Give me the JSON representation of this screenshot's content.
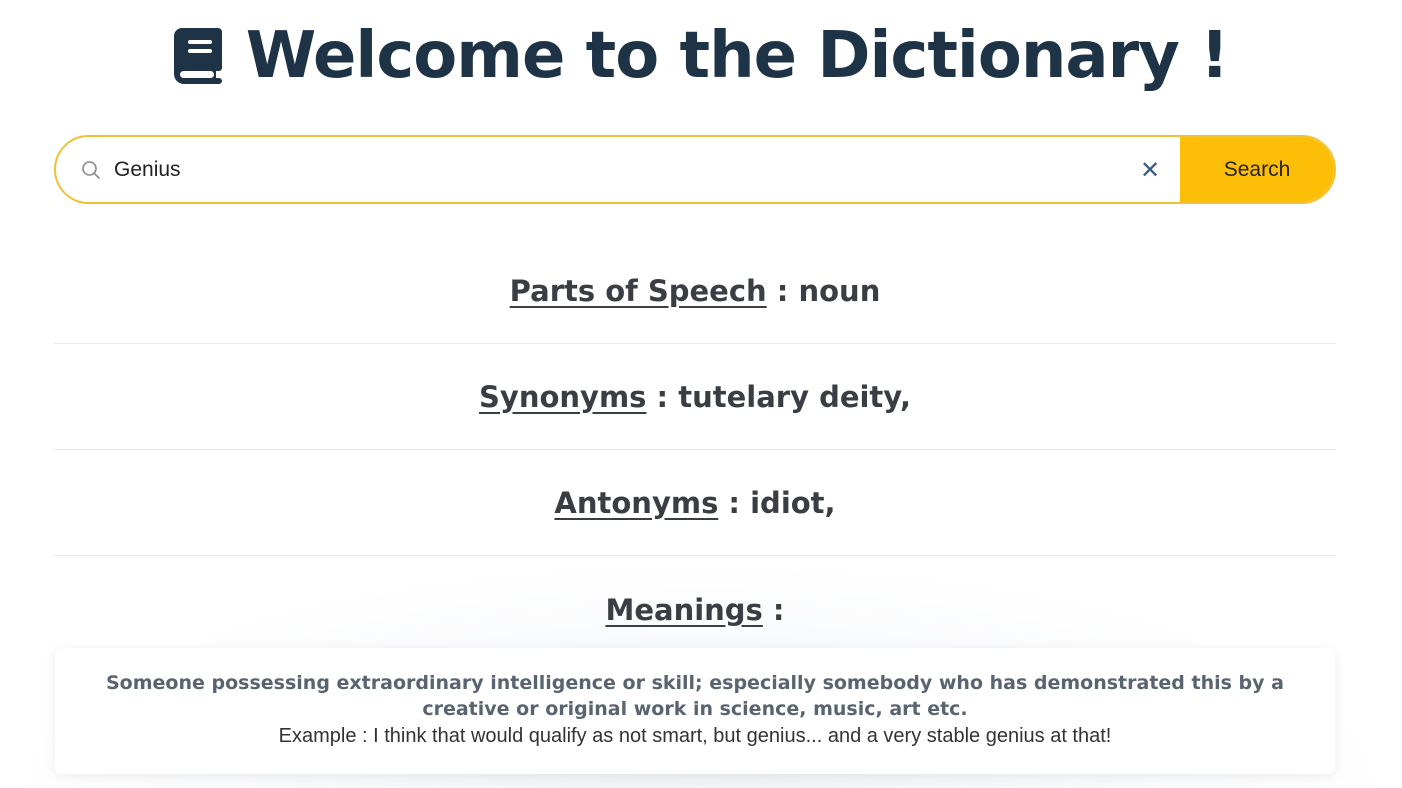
{
  "header": {
    "title": "Welcome to the Dictionary !",
    "icon": "book-icon"
  },
  "search": {
    "value": "Genius",
    "placeholder": "",
    "icon": "search-icon",
    "clear_label": "✕",
    "button_label": "Search",
    "accent_color": "#fcbe06"
  },
  "results": {
    "parts_of_speech": {
      "label": "Parts of Speech",
      "value": " : noun"
    },
    "synonyms": {
      "label": "Synonyms",
      "value": " : tutelary deity,"
    },
    "antonyms": {
      "label": "Antonyms",
      "value": " : idiot,"
    },
    "meanings": {
      "label": "Meanings",
      "suffix": " :",
      "items": [
        {
          "definition": "Someone possessing extraordinary intelligence or skill; especially somebody who has demonstrated this by a creative or original work in science, music, art etc.",
          "example": "Example : I think that would qualify as not smart, but genius... and a very stable genius at that!"
        }
      ]
    }
  }
}
